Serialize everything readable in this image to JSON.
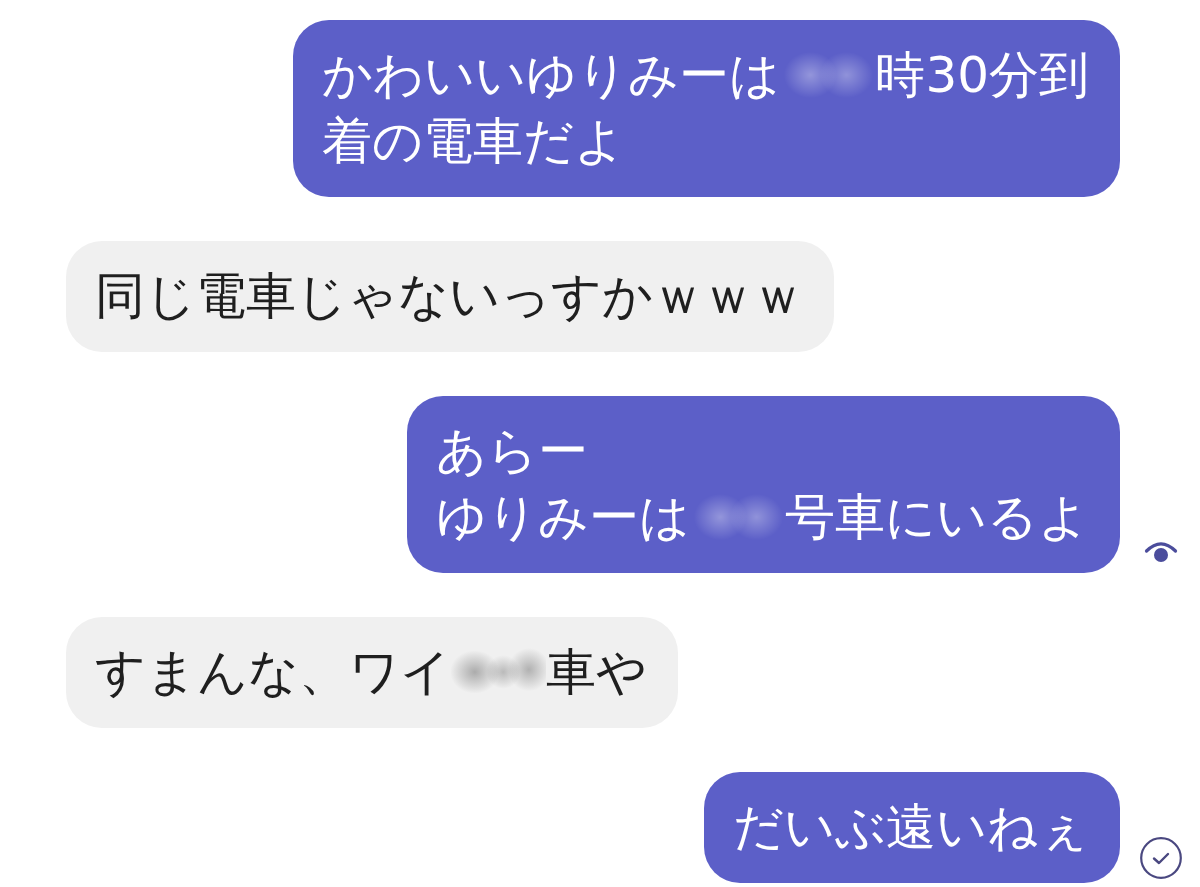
{
  "messages": [
    {
      "outgoing": true,
      "lines": [
        [
          {
            "kind": "text",
            "text": "かわいいゆりみーは"
          },
          {
            "kind": "redaction"
          },
          {
            "kind": "text",
            "text": "時30分到"
          }
        ],
        [
          {
            "kind": "text",
            "text": "着の電車だよ"
          }
        ]
      ]
    },
    {
      "outgoing": false,
      "lines": [
        [
          {
            "kind": "text",
            "text": "同じ電車じゃないっすかｗｗｗ"
          }
        ]
      ]
    },
    {
      "outgoing": true,
      "seen": true,
      "lines": [
        [
          {
            "kind": "text",
            "text": "あらー"
          }
        ],
        [
          {
            "kind": "text",
            "text": "ゆりみーは"
          },
          {
            "kind": "redaction"
          },
          {
            "kind": "text",
            "text": "号車にいるよ"
          }
        ]
      ]
    },
    {
      "outgoing": false,
      "lines": [
        [
          {
            "kind": "text",
            "text": "すまんな、ワイ"
          },
          {
            "kind": "redaction"
          },
          {
            "kind": "text",
            "text": "車や"
          }
        ]
      ]
    },
    {
      "outgoing": true,
      "delivered": true,
      "lines": [
        [
          {
            "kind": "text",
            "text": "だいぶ遠いねぇ"
          }
        ]
      ]
    }
  ]
}
